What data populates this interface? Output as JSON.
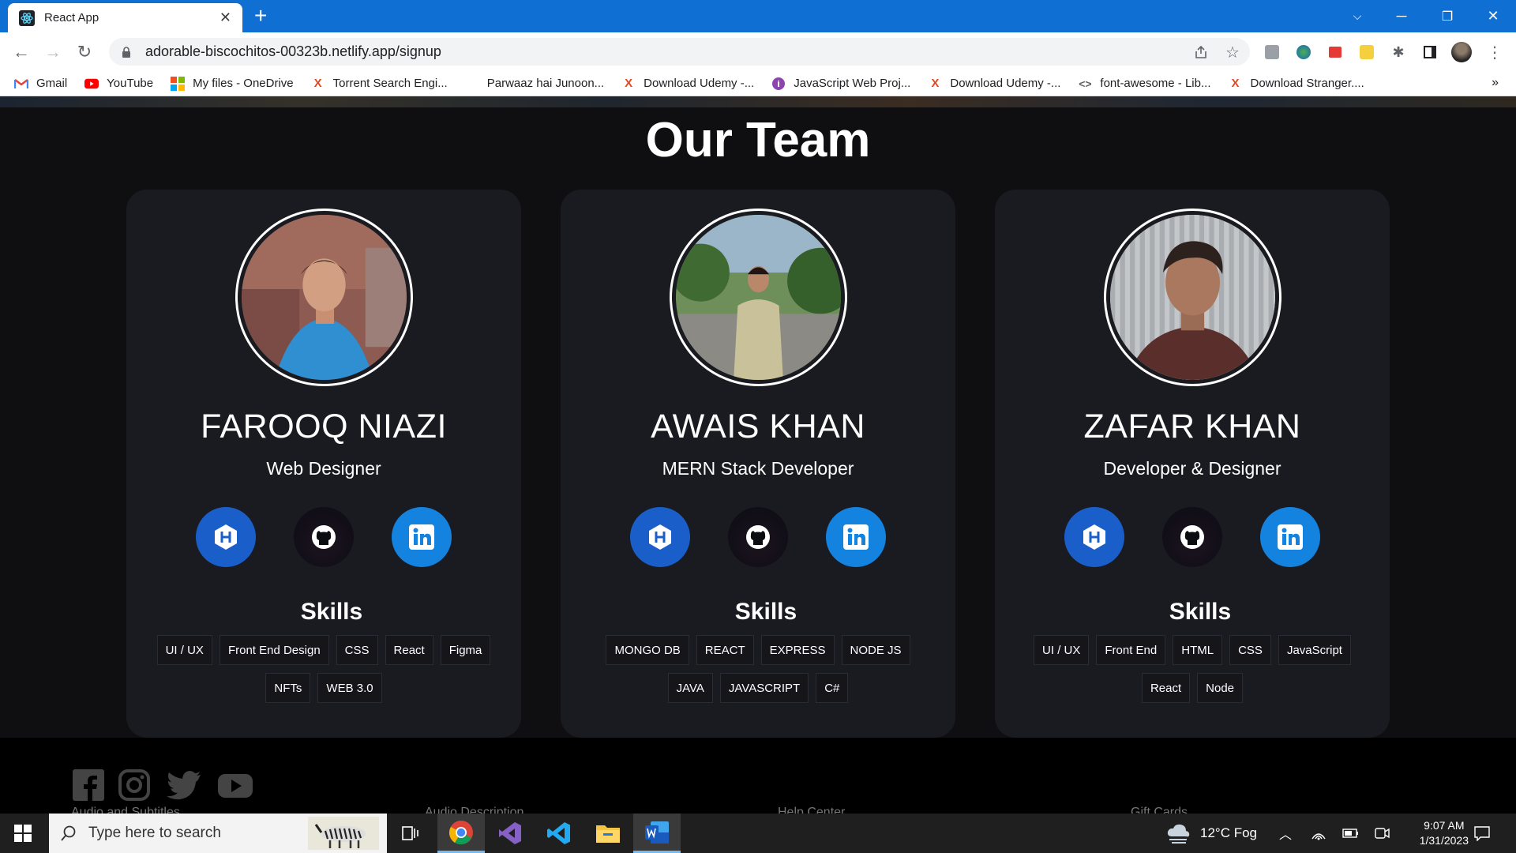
{
  "browser": {
    "tab_title": "React App",
    "url": "adorable-biscochitos-00323b.netlify.app/signup",
    "bookmarks": [
      {
        "label": "Gmail",
        "icon": "gmail-icon"
      },
      {
        "label": "YouTube",
        "icon": "youtube-icon"
      },
      {
        "label": "My files - OneDrive",
        "icon": "microsoft-icon"
      },
      {
        "label": "Torrent Search Engi...",
        "icon": "x-icon"
      },
      {
        "label": "Parwaaz hai Junoon...",
        "icon": "none"
      },
      {
        "label": "Download Udemy -...",
        "icon": "x-icon"
      },
      {
        "label": "JavaScript Web Proj...",
        "icon": "purple-icon"
      },
      {
        "label": "Download Udemy -...",
        "icon": "x-icon"
      },
      {
        "label": "font-awesome - Lib...",
        "icon": "code-icon"
      },
      {
        "label": "Download Stranger....",
        "icon": "x-icon"
      }
    ],
    "more_bookmarks": "»"
  },
  "page": {
    "title": "Our Team",
    "skills_heading": "Skills",
    "members": [
      {
        "name": "FAROOQ NIAZI",
        "role": "Web Designer",
        "skills": [
          "UI / UX",
          "Front End Design",
          "CSS",
          "React",
          "Figma",
          "NFTs",
          "WEB 3.0"
        ]
      },
      {
        "name": "AWAIS KHAN",
        "role": "MERN Stack Developer",
        "skills": [
          "MONGO DB",
          "REACT",
          "EXPRESS",
          "NODE JS",
          "JAVA",
          "JAVASCRIPT",
          "C#"
        ]
      },
      {
        "name": "ZAFAR KHAN",
        "role": "Developer & Designer",
        "skills": [
          "UI / UX",
          "Front End",
          "HTML",
          "CSS",
          "JavaScript",
          "React",
          "Node"
        ]
      }
    ],
    "footer_links": [
      "Audio and Subtitles",
      "Audio Description",
      "Help Center",
      "Gift Cards"
    ]
  },
  "taskbar": {
    "search_placeholder": "Type here to search",
    "weather": "12°C  Fog",
    "time": "9:07 AM",
    "date": "1/31/2023"
  },
  "colors": {
    "chrome_blue": "#0f6fd3",
    "page_bg": "#0f0f11",
    "card_bg": "#1a1a21",
    "hashnode_blue": "#1a5fc9",
    "linkedin_blue": "#1483e0"
  }
}
